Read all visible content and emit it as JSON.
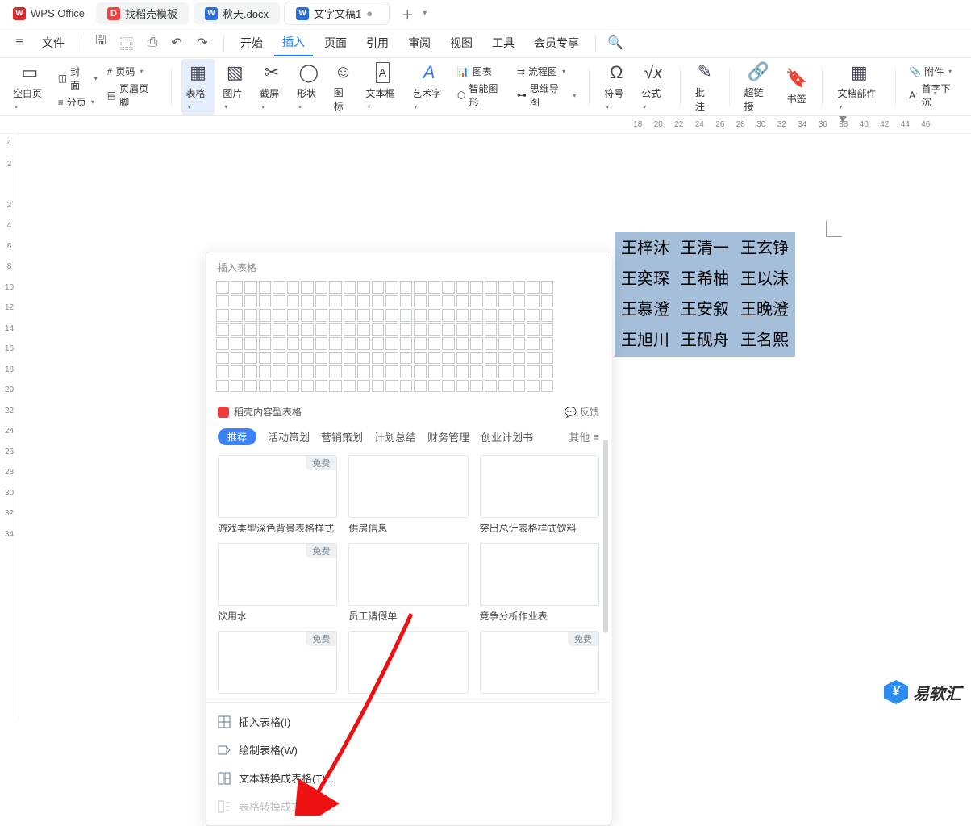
{
  "titlebar": {
    "app": "WPS Office",
    "tabs": [
      {
        "label": "找稻壳模板",
        "type": "doke"
      },
      {
        "label": "秋天.docx",
        "type": "doc"
      },
      {
        "label": "文字文稿1",
        "type": "doc",
        "active": true
      }
    ]
  },
  "menubar": {
    "file": "文件",
    "items": [
      "开始",
      "插入",
      "页面",
      "引用",
      "审阅",
      "视图",
      "工具",
      "会员专享"
    ],
    "active_index": 1
  },
  "ribbon": {
    "blank_page": "空白页",
    "cover": "封面",
    "page_num": "页码",
    "pagination": "分页",
    "header_footer": "页眉页脚",
    "table": "表格",
    "picture": "图片",
    "screenshot": "截屏",
    "shape": "形状",
    "icon": "图标",
    "textbox": "文本框",
    "wordart": "艺术字",
    "chart": "图表",
    "flowchart": "流程图",
    "smartart": "智能图形",
    "mindmap": "思维导图",
    "symbol": "符号",
    "formula": "公式",
    "comment": "批注",
    "hyperlink": "超链接",
    "bookmark": "书签",
    "docparts": "文档部件",
    "attachment": "附件",
    "dropcap": "首字下沉"
  },
  "ruler": {
    "start": 18,
    "end": 46
  },
  "vruler_values": [
    "4",
    "2",
    "",
    "2",
    "4",
    "6",
    "8",
    "10",
    "12",
    "14",
    "16",
    "18",
    "20",
    "22",
    "24",
    "26",
    "28",
    "30",
    "32",
    "34"
  ],
  "selection_rows": [
    [
      "王梓沐",
      "王清一",
      "王玄铮"
    ],
    [
      "王奕琛",
      "王希柚",
      "王以沫"
    ],
    [
      "王慕澄",
      "王安叙",
      "王晚澄"
    ],
    [
      "王旭川",
      "王砚舟",
      "王名熙"
    ]
  ],
  "dropdown": {
    "title": "插入表格",
    "grid": {
      "rows": 8,
      "cols": 24
    },
    "docker_title": "稻壳内容型表格",
    "feedback": "反馈",
    "chip": "推荐",
    "cats": [
      "活动策划",
      "营销策划",
      "计划总结",
      "财务管理",
      "创业计划书"
    ],
    "other": "其他",
    "free": "免费",
    "templates_row1": [
      "游戏类型深色背景表格样式",
      "供房信息",
      "突出总计表格样式饮料"
    ],
    "templates_row2": [
      "饮用水",
      "员工请假单",
      "竞争分析作业表"
    ],
    "menu_items": {
      "insert": "插入表格(I)",
      "draw": "绘制表格(W)",
      "text2table": "文本转换成表格(T)...",
      "table2text": "表格转换成文本(F)..."
    }
  },
  "watermark": "易软汇"
}
